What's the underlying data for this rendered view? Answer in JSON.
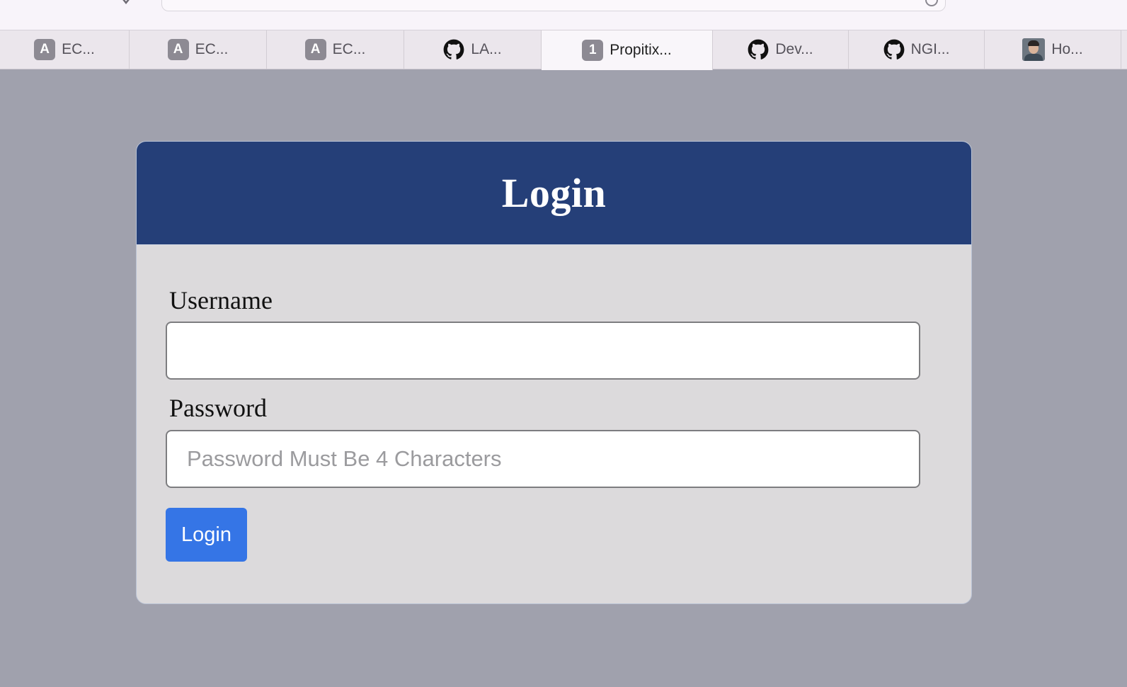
{
  "browser": {
    "tabs": [
      {
        "label": "EC...",
        "favicon": "letter",
        "letter": "A",
        "width": 183
      },
      {
        "label": "EC...",
        "favicon": "letter",
        "letter": "A",
        "width": 194
      },
      {
        "label": "EC...",
        "favicon": "letter",
        "letter": "A",
        "width": 194
      },
      {
        "label": "LA...",
        "favicon": "github",
        "width": 194
      },
      {
        "label": "Propitix...",
        "favicon": "letter",
        "letter": "1",
        "width": 242,
        "active": true
      },
      {
        "label": "Dev...",
        "favicon": "github",
        "width": 192
      },
      {
        "label": "NGI...",
        "favicon": "github",
        "width": 192
      },
      {
        "label": "Ho...",
        "favicon": "photo",
        "width": 193
      }
    ]
  },
  "login": {
    "title": "Login",
    "username_label": "Username",
    "username_value": "",
    "password_label": "Password",
    "password_placeholder": "Password Must Be 4 Characters",
    "submit_label": "Login"
  },
  "colors": {
    "page_background": "#a0a1ad",
    "header_background": "#253f78",
    "card_body": "#dcdadc",
    "button": "#3575e6"
  }
}
